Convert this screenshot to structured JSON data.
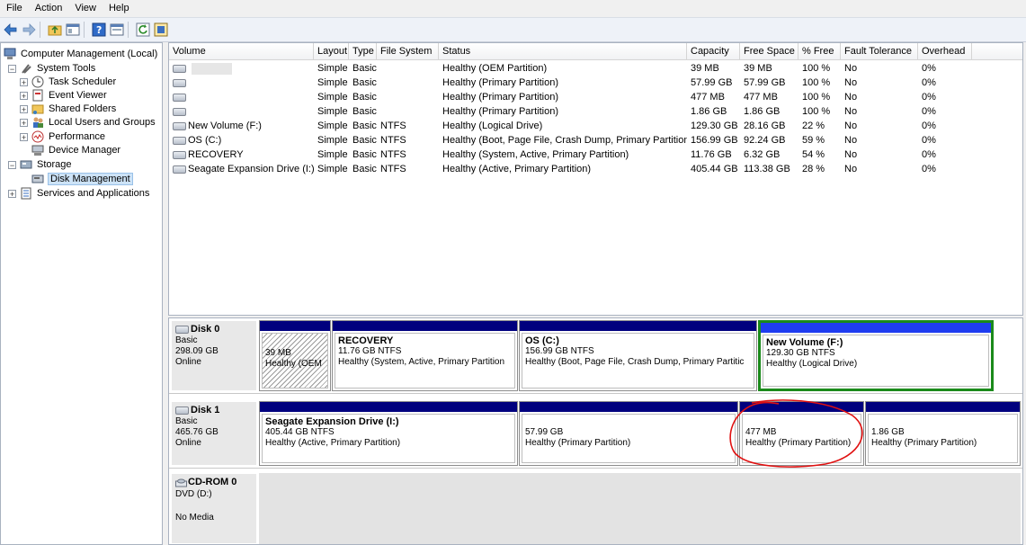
{
  "menu": [
    "File",
    "Action",
    "View",
    "Help"
  ],
  "toolbar_icons": [
    "back-icon",
    "forward-icon",
    "up-folder-icon",
    "show-hide-tree-icon",
    "help-icon",
    "properties-icon",
    "refresh-icon",
    "export-icon"
  ],
  "tree": {
    "root": "Computer Management (Local)",
    "system_tools": "System Tools",
    "task_scheduler": "Task Scheduler",
    "event_viewer": "Event Viewer",
    "shared_folders": "Shared Folders",
    "local_users": "Local Users and Groups",
    "performance": "Performance",
    "device_manager": "Device Manager",
    "storage": "Storage",
    "disk_management": "Disk Management",
    "services": "Services and Applications"
  },
  "columns": {
    "volume": "Volume",
    "layout": "Layout",
    "type": "Type",
    "fs": "File System",
    "status": "Status",
    "capacity": "Capacity",
    "free": "Free Space",
    "pct": "% Free",
    "fault": "Fault Tolerance",
    "overhead": "Overhead"
  },
  "volumes": [
    {
      "name": "",
      "layout": "Simple",
      "type": "Basic",
      "fs": "",
      "status": "Healthy (OEM Partition)",
      "capacity": "39 MB",
      "free": "39 MB",
      "pct": "100 %",
      "fault": "No",
      "overhead": "0%"
    },
    {
      "name": "",
      "layout": "Simple",
      "type": "Basic",
      "fs": "",
      "status": "Healthy (Primary Partition)",
      "capacity": "57.99 GB",
      "free": "57.99 GB",
      "pct": "100 %",
      "fault": "No",
      "overhead": "0%"
    },
    {
      "name": "",
      "layout": "Simple",
      "type": "Basic",
      "fs": "",
      "status": "Healthy (Primary Partition)",
      "capacity": "477 MB",
      "free": "477 MB",
      "pct": "100 %",
      "fault": "No",
      "overhead": "0%"
    },
    {
      "name": "",
      "layout": "Simple",
      "type": "Basic",
      "fs": "",
      "status": "Healthy (Primary Partition)",
      "capacity": "1.86 GB",
      "free": "1.86 GB",
      "pct": "100 %",
      "fault": "No",
      "overhead": "0%"
    },
    {
      "name": "New Volume (F:)",
      "layout": "Simple",
      "type": "Basic",
      "fs": "NTFS",
      "status": "Healthy (Logical Drive)",
      "capacity": "129.30 GB",
      "free": "28.16 GB",
      "pct": "22 %",
      "fault": "No",
      "overhead": "0%"
    },
    {
      "name": "OS (C:)",
      "layout": "Simple",
      "type": "Basic",
      "fs": "NTFS",
      "status": "Healthy (Boot, Page File, Crash Dump, Primary Partition)",
      "capacity": "156.99 GB",
      "free": "92.24 GB",
      "pct": "59 %",
      "fault": "No",
      "overhead": "0%"
    },
    {
      "name": "RECOVERY",
      "layout": "Simple",
      "type": "Basic",
      "fs": "NTFS",
      "status": "Healthy (System, Active, Primary Partition)",
      "capacity": "11.76 GB",
      "free": "6.32 GB",
      "pct": "54 %",
      "fault": "No",
      "overhead": "0%"
    },
    {
      "name": "Seagate Expansion Drive (I:)",
      "layout": "Simple",
      "type": "Basic",
      "fs": "NTFS",
      "status": "Healthy (Active, Primary Partition)",
      "capacity": "405.44 GB",
      "free": "113.38 GB",
      "pct": "28 %",
      "fault": "No",
      "overhead": "0%"
    }
  ],
  "disk0": {
    "name": "Disk 0",
    "kind": "Basic",
    "size": "298.09 GB",
    "state": "Online",
    "parts": [
      {
        "name": "",
        "size": "39 MB",
        "status": "Healthy (OEM"
      },
      {
        "name": "RECOVERY",
        "size": "11.76 GB NTFS",
        "status": "Healthy (System, Active, Primary Partition"
      },
      {
        "name": "OS  (C:)",
        "size": "156.99 GB NTFS",
        "status": "Healthy (Boot, Page File, Crash Dump, Primary Partitic"
      },
      {
        "name": "New Volume  (F:)",
        "size": "129.30 GB NTFS",
        "status": "Healthy (Logical Drive)"
      }
    ]
  },
  "disk1": {
    "name": "Disk 1",
    "kind": "Basic",
    "size": "465.76 GB",
    "state": "Online",
    "parts": [
      {
        "name": "Seagate Expansion Drive  (I:)",
        "size": "405.44 GB NTFS",
        "status": "Healthy (Active, Primary Partition)"
      },
      {
        "name": "",
        "size": "57.99 GB",
        "status": "Healthy (Primary Partition)"
      },
      {
        "name": "",
        "size": "477 MB",
        "status": "Healthy (Primary Partition)"
      },
      {
        "name": "",
        "size": "1.86 GB",
        "status": "Healthy (Primary Partition)"
      }
    ]
  },
  "cdrom": {
    "name": "CD-ROM 0",
    "drive": "DVD (D:)",
    "media": "No Media"
  },
  "colors": {
    "primary_bar": "#00007e",
    "logical_bar": "#1f3cf0",
    "extended_border": "#1b8a1b",
    "annotation": "#e01010"
  }
}
